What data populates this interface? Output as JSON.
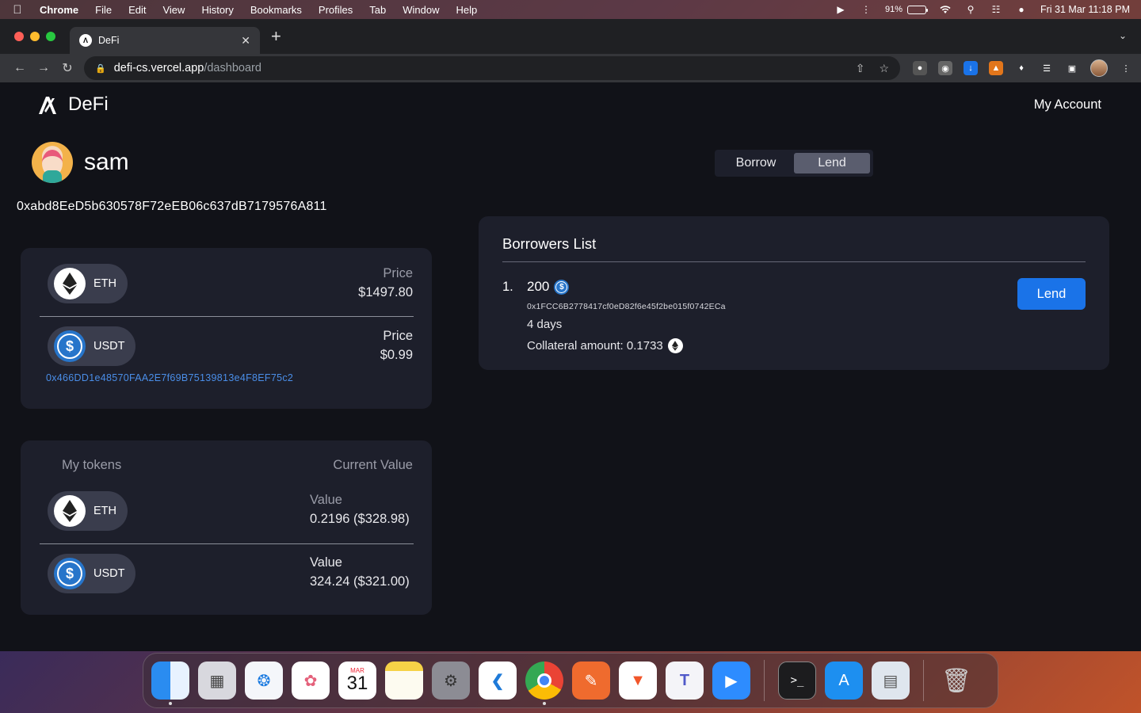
{
  "menubar": {
    "items": [
      "Chrome",
      "File",
      "Edit",
      "View",
      "History",
      "Bookmarks",
      "Profiles",
      "Tab",
      "Window",
      "Help"
    ],
    "battery": "91%",
    "battery_level": 0.91,
    "datetime": "Fri 31 Mar  11:18 PM"
  },
  "browser": {
    "tab_title": "DeFi",
    "url_host": "defi-cs.vercel.app",
    "url_path": "/dashboard"
  },
  "app": {
    "brand": "DeFi",
    "account_label": "My Account",
    "username": "sam",
    "wallet_address": "0xabd8EeD5b630578F72eEB06c637dB7179576A811"
  },
  "prices": {
    "tokens": [
      {
        "symbol": "ETH",
        "label": "Price",
        "value": "$1497.80"
      },
      {
        "symbol": "USDT",
        "label": "Price",
        "value": "$0.99"
      }
    ],
    "usdt_contract": "0x466DD1e48570FAA2E7f69B75139813e4F8EF75c2"
  },
  "holdings": {
    "header_left": "My tokens",
    "header_right": "Current Value",
    "tokens": [
      {
        "symbol": "ETH",
        "label": "Value",
        "value": "0.2196 ($328.98)"
      },
      {
        "symbol": "USDT",
        "label": "Value",
        "value": "324.24 ($321.00)"
      }
    ]
  },
  "mode_toggle": {
    "options": [
      "Borrow",
      "Lend"
    ],
    "selected": "Lend"
  },
  "borrowers": {
    "title": "Borrowers List",
    "entries": [
      {
        "index": "1.",
        "amount": "200",
        "address": "0x1FCC6B2778417cf0eD82f6e45f2be015f0742ECa",
        "duration": "4 days",
        "collateral": "Collateral amount: 0.1733",
        "action": "Lend"
      }
    ]
  },
  "dock": {
    "apps": [
      "finder-icon",
      "launchpad-icon",
      "safari-icon",
      "photos-icon",
      "calendar-icon",
      "notes-icon",
      "system-settings-icon",
      "vscode-icon",
      "chrome-icon",
      "postman-icon",
      "brave-icon",
      "teams-icon",
      "zoom-icon",
      "terminal-icon",
      "app-store-icon",
      "preview-icon",
      "trash-icon"
    ],
    "calendar_month": "MAR",
    "calendar_day": "31"
  }
}
